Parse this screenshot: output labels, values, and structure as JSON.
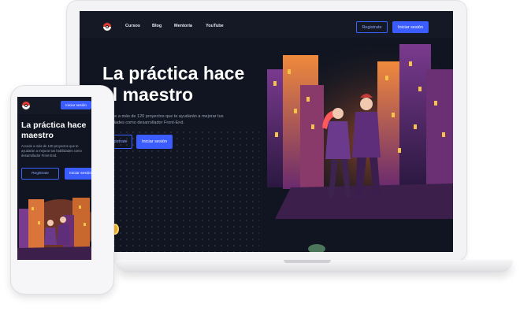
{
  "laptop": {
    "nav": {
      "links": [
        "Cursos",
        "Blog",
        "Mentoría",
        "YouTube"
      ],
      "register_label": "Registrate",
      "login_label": "Iniciar sesión"
    },
    "hero": {
      "title_line1": "La práctica hace",
      "title_line2": "el maestro",
      "description_line1": "Accede a más de 120 proyectos que te ayudarán a mejorar tus",
      "description_line2": "habilidades como desarrollador Front-End.",
      "register_label": "Registrate",
      "login_label": "Iniciar sesión"
    }
  },
  "phone": {
    "login_label": "Iniciar sesión",
    "hero": {
      "title_line1": "La práctica hace",
      "title_line2": "maestro",
      "description_line1": "Accede a más de 120 proyectos que te",
      "description_line2": "ayudarán a mejorar tus habilidades como",
      "description_line3": "desarrollador Front-End.",
      "register_label": "Registrate",
      "login_label": "Iniciar sesión"
    }
  },
  "colors": {
    "screen_bg": "#101521",
    "accent_blue": "#3b5cff",
    "building_purple": "#5a2c78",
    "window_glow": "#f7a93a"
  },
  "icons": [
    "pokeball-logo-icon"
  ]
}
